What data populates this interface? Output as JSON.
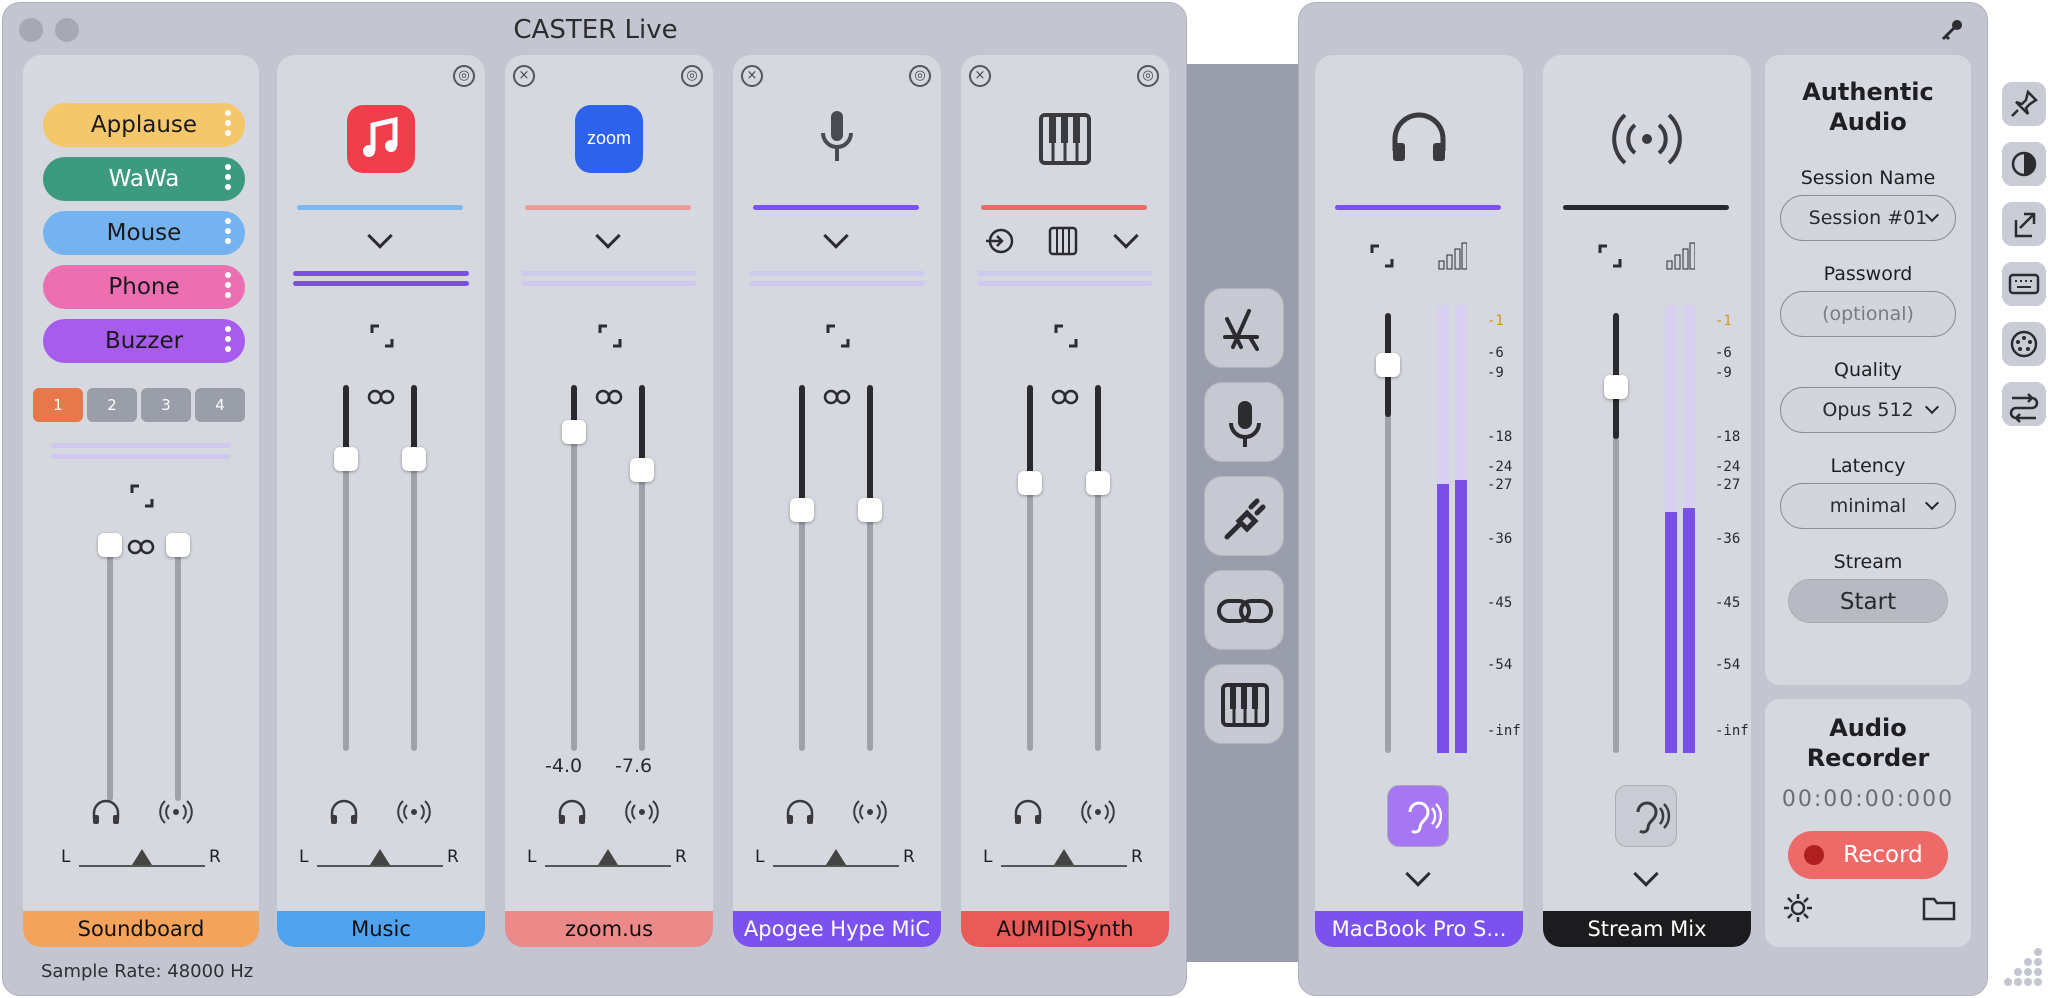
{
  "window": {
    "title": "CASTER Live",
    "sample_rate": "Sample Rate: 48000 Hz"
  },
  "soundboard": {
    "buttons": [
      {
        "label": "Applause",
        "color": "#f5c76b"
      },
      {
        "label": "WaWa",
        "color": "#3c9a7e"
      },
      {
        "label": "Mouse",
        "color": "#74b3ef"
      },
      {
        "label": "Phone",
        "color": "#ec6fb1"
      },
      {
        "label": "Buzzer",
        "color": "#a75ced"
      }
    ],
    "pages": [
      "1",
      "2",
      "3",
      "4"
    ],
    "active_page": "1",
    "footer": "Soundboard",
    "footer_color": "#f3a35b",
    "pan_l": "L",
    "pan_r": "R"
  },
  "channels": [
    {
      "name": "Music",
      "footer_color": "#4ea2ee",
      "icon": "music-app-icon",
      "accent": "#7fb7ee",
      "db_left": "",
      "db_right": "",
      "pan_l": "L",
      "pan_r": "R"
    },
    {
      "name": "zoom.us",
      "footer_color": "#ec8a8a",
      "icon": "zoom-app-icon",
      "icon_text": "zoom",
      "accent": "#ec9a9a",
      "db_left": "-4.0",
      "db_right": "-7.6",
      "pan_l": "L",
      "pan_r": "R"
    },
    {
      "name": "Apogee Hype MiC",
      "footer_color": "#7b52f0",
      "icon": "microphone-icon",
      "accent": "#7b52f0",
      "db_left": "",
      "db_right": "",
      "pan_l": "L",
      "pan_r": "R"
    },
    {
      "name": "AUMIDISynth",
      "footer_color": "#ea5a58",
      "icon": "piano-icon",
      "accent": "#ea6b6b",
      "db_left": "",
      "db_right": "",
      "pan_l": "L",
      "pan_r": "R"
    }
  ],
  "outputs": [
    {
      "name": "MacBook Pro S...",
      "footer_color": "#7b52f0",
      "icon": "headphones-icon",
      "accent": "#7b52f0"
    },
    {
      "name": "Stream Mix",
      "footer_color": "#1c1c1e",
      "icon": "broadcast-icon",
      "accent": "#2a2a2e"
    }
  ],
  "meter_scale": [
    "-1",
    "-6",
    "-9",
    "-18",
    "-24",
    "-27",
    "-36",
    "-45",
    "-54",
    "-inf"
  ],
  "middle_tools": [
    "app-store-icon",
    "microphone-icon",
    "cable-plug-icon",
    "link-icon",
    "piano-icon"
  ],
  "streaming": {
    "title": "Authentic Audio",
    "session_label": "Session Name",
    "session_value": "Session #01",
    "password_label": "Password",
    "password_placeholder": "(optional)",
    "quality_label": "Quality",
    "quality_value": "Opus 512",
    "latency_label": "Latency",
    "latency_value": "minimal",
    "stream_label": "Stream",
    "start_label": "Start"
  },
  "recorder": {
    "title": "Audio Recorder",
    "time": "00:00:00:000",
    "record_label": "Record",
    "record_color": "#ee6a68"
  },
  "right_toolbar": [
    "pin-icon",
    "contrast-icon",
    "export-icon",
    "keyboard-icon",
    "midi-icon",
    "routing-icon"
  ]
}
